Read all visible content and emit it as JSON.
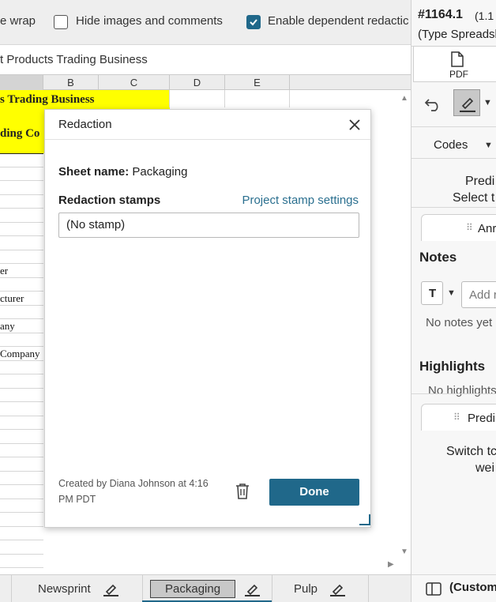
{
  "toolbar": {
    "wrap_label": "e wrap",
    "hide_images_label": "Hide images and comments",
    "hide_images_checked": false,
    "dependent_label": "Enable dependent redactic",
    "dependent_checked": true
  },
  "sheet": {
    "formula_text": "t Products Trading Business",
    "columns": [
      "B",
      "C",
      "D",
      "E"
    ],
    "title_cell": "s Trading Business",
    "title_cell_2": "ding Co",
    "rows": [
      "",
      "",
      "",
      "",
      "",
      "",
      "",
      "",
      "er",
      "",
      "cturer",
      "",
      "any",
      "",
      "Company",
      "",
      "",
      "",
      "",
      "",
      "",
      "",
      "",
      "",
      "",
      "",
      "",
      "",
      "",
      "",
      ""
    ]
  },
  "tabs": [
    {
      "label": "Newsprint"
    },
    {
      "label": "Packaging"
    },
    {
      "label": "Pulp"
    }
  ],
  "dialog": {
    "title": "Redaction",
    "sheet_name_key": "Sheet name:",
    "sheet_name_value": "Packaging",
    "stamps_label": "Redaction stamps",
    "stamp_settings_link": "Project stamp settings",
    "stamp_value": "(No stamp)",
    "created_text": "Created by Diana Johnson at 4:16 PM PDT",
    "done_label": "Done"
  },
  "right": {
    "doc_id": "#1164.1",
    "doc_version": "(1.1",
    "doc_type": "(Type Spreadsh",
    "pdf_label": "PDF",
    "codes_label": "Codes",
    "predict_1": "Predi",
    "predict_2": "Select t",
    "ann_tab": "Anr",
    "notes_title": "Notes",
    "note_format_button": "T",
    "notes_placeholder": "Add r",
    "no_notes": "No notes yet",
    "highlights_title": "Highlights",
    "no_highlights": "No highlights",
    "predict_tab": "Predi",
    "switch_1": "Switch tc",
    "switch_2": "wei",
    "custom_label": "(Custom"
  },
  "colors": {
    "accent": "#20688a",
    "highlight": "#ffff00"
  }
}
